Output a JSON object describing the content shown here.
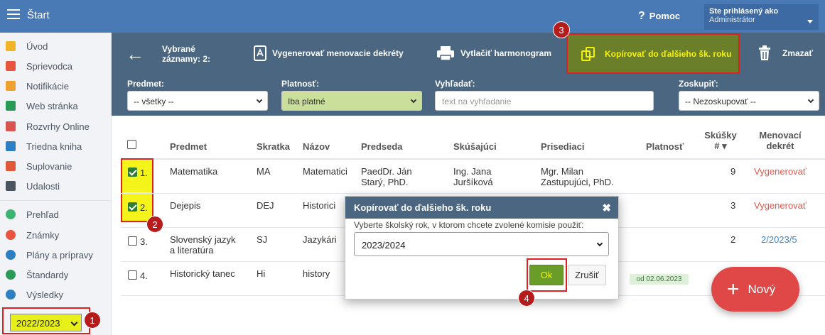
{
  "topbar": {
    "title": "Štart",
    "help": "Pomoc",
    "user_line1": "Ste prihlásený ako",
    "user_line2": "Administrátor"
  },
  "sidebar": {
    "items": [
      {
        "label": "Úvod",
        "color": "#f0b429"
      },
      {
        "label": "Sprievodca",
        "color": "#e8553e"
      },
      {
        "label": "Notifikácie",
        "color": "#f0a030"
      },
      {
        "label": "Web stránka",
        "color": "#2b9a57"
      },
      {
        "label": "Rozvrhy Online",
        "color": "#d9534f"
      },
      {
        "label": "Triedna kniha",
        "color": "#2d7fc1"
      },
      {
        "label": "Suplovanie",
        "color": "#e05a3a"
      },
      {
        "label": "Udalosti",
        "color": "#4a5560"
      },
      {
        "label": "Prehľad",
        "color": "#3cb371"
      },
      {
        "label": "Známky",
        "color": "#e8553e"
      },
      {
        "label": "Plány a prípravy",
        "color": "#2d7fc1"
      },
      {
        "label": "Štandardy",
        "color": "#2b9a57"
      },
      {
        "label": "Výsledky",
        "color": "#2d7fc1"
      }
    ],
    "year": "2022/2023"
  },
  "toolbar": {
    "selected_line1": "Vybrané",
    "selected_line2": "záznamy: 2:",
    "generate": "Vygenerovať menovacie dekréty",
    "print": "Vytlačiť harmonogram",
    "copy": "Kopírovať do ďalšieho šk. roku",
    "delete": "Zmazať"
  },
  "filters": {
    "predmet_label": "Predmet:",
    "predmet_value": "-- všetky --",
    "platnost_label": "Platnosť:",
    "platnost_value": "Iba platné",
    "search_label": "Vyhľadať:",
    "search_placeholder": "text na vyhľadanie",
    "group_label": "Zoskupiť:",
    "group_value": "-- Nezoskupovať --"
  },
  "table": {
    "headers": {
      "predmet": "Predmet",
      "skratka": "Skratka",
      "nazov": "Názov",
      "predseda": "Predseda",
      "skusajuci": "Skúšajúci",
      "prisediaci": "Prisediaci",
      "platnost": "Platnosť",
      "skusky1": "Skúšky",
      "skusky2": "#",
      "menovaci1": "Menovací",
      "menovaci2": "dekrét"
    },
    "rows": [
      {
        "num": "1.",
        "predmet": "Matematika",
        "skratka": "MA",
        "nazov": "Matematici",
        "predseda1": "PaedDr. Ján",
        "predseda2": "Starý, PhD.",
        "skusajuci1": "Ing. Jana",
        "skusajuci2": "Juršíková",
        "prisediaci1": "Mgr. Milan",
        "prisediaci2": "Zastupujúci, PhD.",
        "platnost": "",
        "skusky": "9",
        "dekret": "Vygenerovať"
      },
      {
        "num": "2.",
        "predmet": "Dejepis",
        "skratka": "DEJ",
        "nazov": "Historici",
        "platnost": "",
        "skusky": "3",
        "dekret": "Vygenerovať"
      },
      {
        "num": "3.",
        "predmet1": "Slovenský jazyk",
        "predmet2": "a literatúra",
        "skratka": "SJ",
        "nazov": "Jazykári",
        "skusky": "2",
        "dekret": "2/2023/5"
      },
      {
        "num": "4.",
        "predmet": "Historický tanec",
        "skratka": "Hi",
        "nazov": "history",
        "platnost": "od 02.06.2023"
      }
    ]
  },
  "modal": {
    "title": "Kopírovať do ďalšieho šk. roku",
    "text": "Vyberte školský rok, v ktorom chcete zvolené komisie použiť:",
    "selected_year": "2023/2024",
    "ok": "Ok",
    "cancel": "Zrušiť"
  },
  "fab": {
    "label": "Nový"
  },
  "badges": {
    "b1": "1",
    "b2": "2",
    "b3": "3",
    "b4": "4"
  }
}
